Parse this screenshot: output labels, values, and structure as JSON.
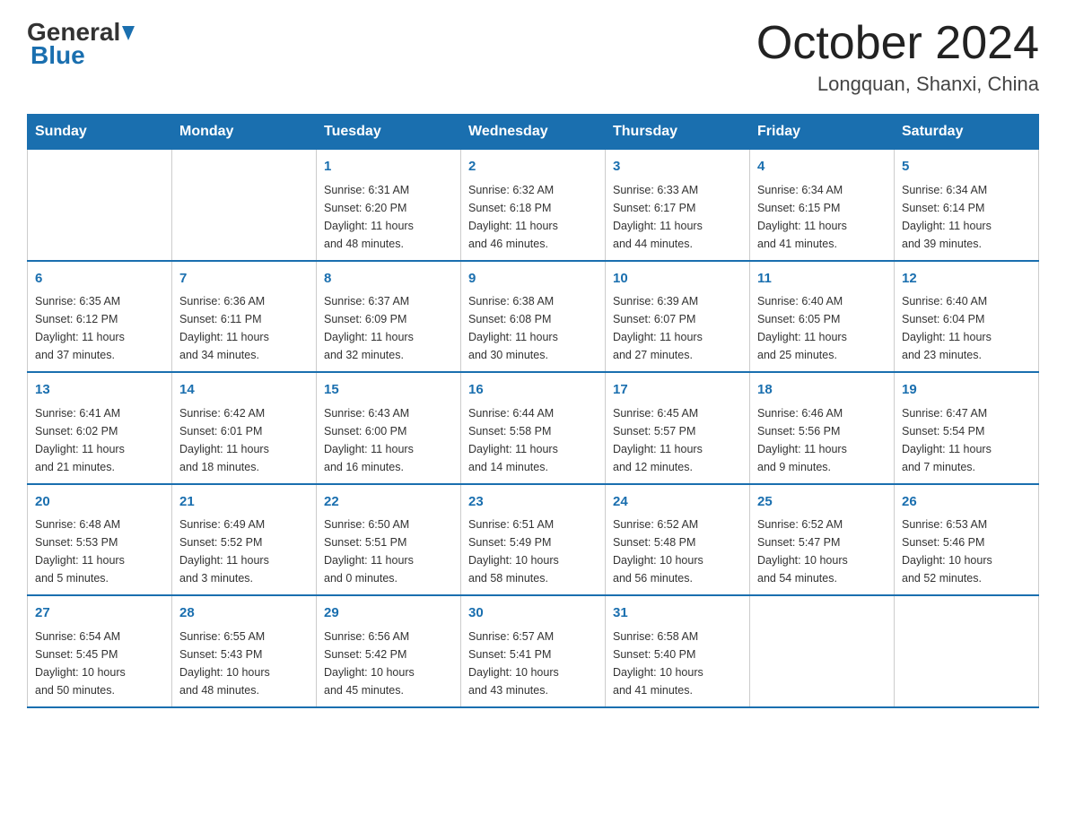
{
  "header": {
    "logo": {
      "general": "General",
      "blue": "Blue",
      "underline": "Blue"
    },
    "title": "October 2024",
    "location": "Longquan, Shanxi, China"
  },
  "weekdays": [
    "Sunday",
    "Monday",
    "Tuesday",
    "Wednesday",
    "Thursday",
    "Friday",
    "Saturday"
  ],
  "weeks": [
    [
      {
        "day": "",
        "info": ""
      },
      {
        "day": "",
        "info": ""
      },
      {
        "day": "1",
        "info": "Sunrise: 6:31 AM\nSunset: 6:20 PM\nDaylight: 11 hours\nand 48 minutes."
      },
      {
        "day": "2",
        "info": "Sunrise: 6:32 AM\nSunset: 6:18 PM\nDaylight: 11 hours\nand 46 minutes."
      },
      {
        "day": "3",
        "info": "Sunrise: 6:33 AM\nSunset: 6:17 PM\nDaylight: 11 hours\nand 44 minutes."
      },
      {
        "day": "4",
        "info": "Sunrise: 6:34 AM\nSunset: 6:15 PM\nDaylight: 11 hours\nand 41 minutes."
      },
      {
        "day": "5",
        "info": "Sunrise: 6:34 AM\nSunset: 6:14 PM\nDaylight: 11 hours\nand 39 minutes."
      }
    ],
    [
      {
        "day": "6",
        "info": "Sunrise: 6:35 AM\nSunset: 6:12 PM\nDaylight: 11 hours\nand 37 minutes."
      },
      {
        "day": "7",
        "info": "Sunrise: 6:36 AM\nSunset: 6:11 PM\nDaylight: 11 hours\nand 34 minutes."
      },
      {
        "day": "8",
        "info": "Sunrise: 6:37 AM\nSunset: 6:09 PM\nDaylight: 11 hours\nand 32 minutes."
      },
      {
        "day": "9",
        "info": "Sunrise: 6:38 AM\nSunset: 6:08 PM\nDaylight: 11 hours\nand 30 minutes."
      },
      {
        "day": "10",
        "info": "Sunrise: 6:39 AM\nSunset: 6:07 PM\nDaylight: 11 hours\nand 27 minutes."
      },
      {
        "day": "11",
        "info": "Sunrise: 6:40 AM\nSunset: 6:05 PM\nDaylight: 11 hours\nand 25 minutes."
      },
      {
        "day": "12",
        "info": "Sunrise: 6:40 AM\nSunset: 6:04 PM\nDaylight: 11 hours\nand 23 minutes."
      }
    ],
    [
      {
        "day": "13",
        "info": "Sunrise: 6:41 AM\nSunset: 6:02 PM\nDaylight: 11 hours\nand 21 minutes."
      },
      {
        "day": "14",
        "info": "Sunrise: 6:42 AM\nSunset: 6:01 PM\nDaylight: 11 hours\nand 18 minutes."
      },
      {
        "day": "15",
        "info": "Sunrise: 6:43 AM\nSunset: 6:00 PM\nDaylight: 11 hours\nand 16 minutes."
      },
      {
        "day": "16",
        "info": "Sunrise: 6:44 AM\nSunset: 5:58 PM\nDaylight: 11 hours\nand 14 minutes."
      },
      {
        "day": "17",
        "info": "Sunrise: 6:45 AM\nSunset: 5:57 PM\nDaylight: 11 hours\nand 12 minutes."
      },
      {
        "day": "18",
        "info": "Sunrise: 6:46 AM\nSunset: 5:56 PM\nDaylight: 11 hours\nand 9 minutes."
      },
      {
        "day": "19",
        "info": "Sunrise: 6:47 AM\nSunset: 5:54 PM\nDaylight: 11 hours\nand 7 minutes."
      }
    ],
    [
      {
        "day": "20",
        "info": "Sunrise: 6:48 AM\nSunset: 5:53 PM\nDaylight: 11 hours\nand 5 minutes."
      },
      {
        "day": "21",
        "info": "Sunrise: 6:49 AM\nSunset: 5:52 PM\nDaylight: 11 hours\nand 3 minutes."
      },
      {
        "day": "22",
        "info": "Sunrise: 6:50 AM\nSunset: 5:51 PM\nDaylight: 11 hours\nand 0 minutes."
      },
      {
        "day": "23",
        "info": "Sunrise: 6:51 AM\nSunset: 5:49 PM\nDaylight: 10 hours\nand 58 minutes."
      },
      {
        "day": "24",
        "info": "Sunrise: 6:52 AM\nSunset: 5:48 PM\nDaylight: 10 hours\nand 56 minutes."
      },
      {
        "day": "25",
        "info": "Sunrise: 6:52 AM\nSunset: 5:47 PM\nDaylight: 10 hours\nand 54 minutes."
      },
      {
        "day": "26",
        "info": "Sunrise: 6:53 AM\nSunset: 5:46 PM\nDaylight: 10 hours\nand 52 minutes."
      }
    ],
    [
      {
        "day": "27",
        "info": "Sunrise: 6:54 AM\nSunset: 5:45 PM\nDaylight: 10 hours\nand 50 minutes."
      },
      {
        "day": "28",
        "info": "Sunrise: 6:55 AM\nSunset: 5:43 PM\nDaylight: 10 hours\nand 48 minutes."
      },
      {
        "day": "29",
        "info": "Sunrise: 6:56 AM\nSunset: 5:42 PM\nDaylight: 10 hours\nand 45 minutes."
      },
      {
        "day": "30",
        "info": "Sunrise: 6:57 AM\nSunset: 5:41 PM\nDaylight: 10 hours\nand 43 minutes."
      },
      {
        "day": "31",
        "info": "Sunrise: 6:58 AM\nSunset: 5:40 PM\nDaylight: 10 hours\nand 41 minutes."
      },
      {
        "day": "",
        "info": ""
      },
      {
        "day": "",
        "info": ""
      }
    ]
  ]
}
